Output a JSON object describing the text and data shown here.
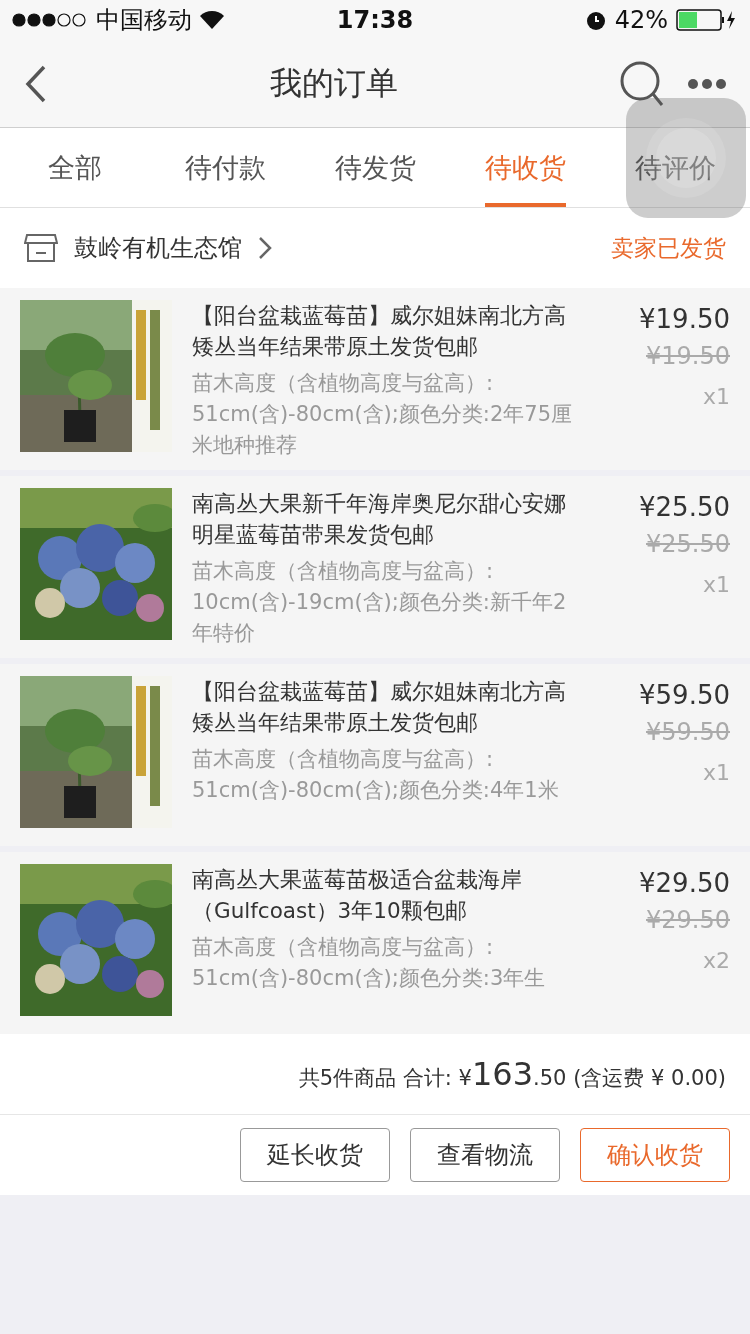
{
  "status_bar": {
    "carrier": "中国移动",
    "time": "17:38",
    "battery": "42%"
  },
  "nav": {
    "title": "我的订单"
  },
  "tabs": [
    {
      "label": "全部",
      "selected": false
    },
    {
      "label": "待付款",
      "selected": false
    },
    {
      "label": "待发货",
      "selected": false
    },
    {
      "label": "待收货",
      "selected": true
    },
    {
      "label": "待评价",
      "selected": false
    }
  ],
  "shop": {
    "name": "鼓岭有机生态馆",
    "status": "卖家已发货"
  },
  "items": [
    {
      "title": "【阳台盆栽蓝莓苗】威尔姐妹南北方高矮丛当年结果带原土发货包邮",
      "spec": "苗木高度（含植物高度与盆高）: 51cm(含)-80cm(含);颜色分类:2年75厘米地种推荐",
      "price": "¥19.50",
      "original_price": "¥19.50",
      "quantity": "x1"
    },
    {
      "title": "南高丛大果新千年海岸奥尼尔甜心安娜明星蓝莓苗带果发货包邮",
      "spec": "苗木高度（含植物高度与盆高）: 10cm(含)-19cm(含);颜色分类:新千年2年特价",
      "price": "¥25.50",
      "original_price": "¥25.50",
      "quantity": "x1"
    },
    {
      "title": "【阳台盆栽蓝莓苗】威尔姐妹南北方高矮丛当年结果带原土发货包邮",
      "spec": "苗木高度（含植物高度与盆高）: 51cm(含)-80cm(含);颜色分类:4年1米",
      "price": "¥59.50",
      "original_price": "¥59.50",
      "quantity": "x1"
    },
    {
      "title": "南高丛大果蓝莓苗极适合盆栽海岸（Gulfcoast）3年10颗包邮",
      "spec": "苗木高度（含植物高度与盆高）: 51cm(含)-80cm(含);颜色分类:3年生",
      "price": "¥29.50",
      "original_price": "¥29.50",
      "quantity": "x2"
    }
  ],
  "summary": {
    "prefix": "共5件商品 合计: ¥",
    "amount_integer": "163",
    "amount_decimal": ".50",
    "shipping": "(含运费 ¥ 0.00)"
  },
  "actions": [
    {
      "label": "延长收货",
      "kind": "plain"
    },
    {
      "label": "查看物流",
      "kind": "plain"
    },
    {
      "label": "确认收货",
      "kind": "primary"
    }
  ]
}
